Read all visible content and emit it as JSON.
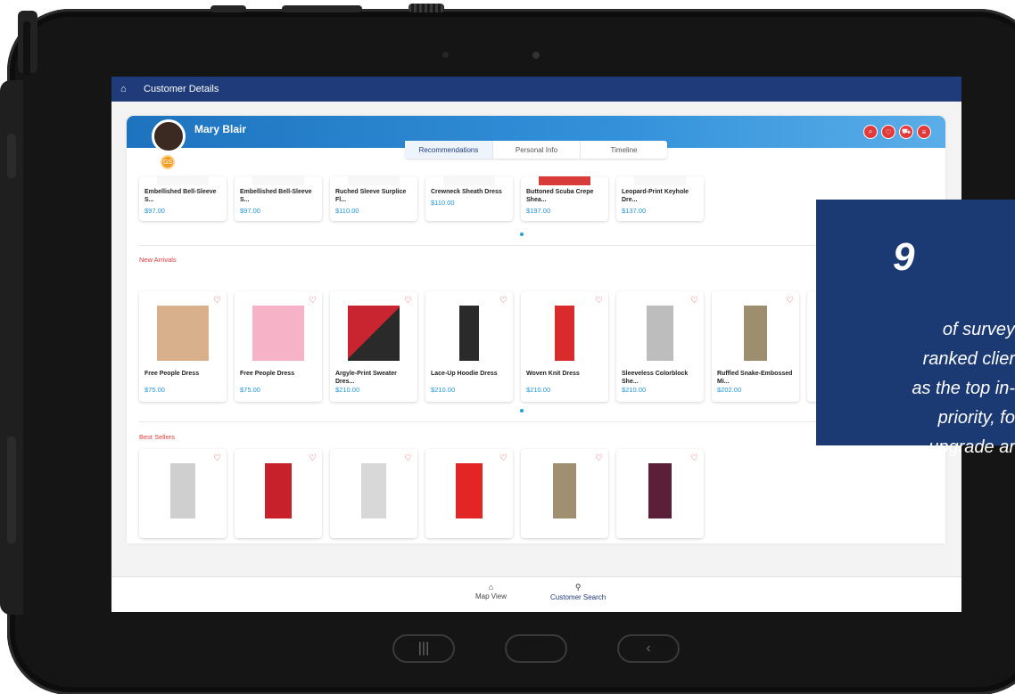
{
  "app": {
    "title": "Customer Details",
    "customer_name": "Mary Blair",
    "badge_text": "GS"
  },
  "tabs": [
    {
      "label": "Recommendations",
      "active": true
    },
    {
      "label": "Personal Info",
      "active": false
    },
    {
      "label": "Timeline",
      "active": false
    }
  ],
  "actions": [
    "search-icon",
    "heart-icon",
    "cart-icon",
    "list-icon"
  ],
  "recommendations": [
    {
      "title": "Embellished Bell-Sleeve S...",
      "price": "$97.00"
    },
    {
      "title": "Embellished Bell-Sleeve S...",
      "price": "$97.00"
    },
    {
      "title": "Ruched Sleeve Surplice Fl...",
      "price": "$110.00"
    },
    {
      "title": "Crewneck Sheath Dress",
      "price": "$110.00"
    },
    {
      "title": "Buttoned Scuba Crepe Shea...",
      "price": "$197.00"
    },
    {
      "title": "Leopard-Print Keyhole Dre...",
      "price": "$137.00"
    }
  ],
  "new_arrivals": {
    "title": "New Arrivals",
    "items": [
      {
        "title": "Free People Dress",
        "price": "$75.00"
      },
      {
        "title": "Free People Dress",
        "price": "$75.00"
      },
      {
        "title": "Argyle-Print Sweater Dres...",
        "price": "$210.00"
      },
      {
        "title": "Lace-Up Hoodie Dress",
        "price": "$210.00"
      },
      {
        "title": "Woven Knit Dress",
        "price": "$210.00"
      },
      {
        "title": "Sleeveless Colorblock She...",
        "price": "$210.00"
      },
      {
        "title": "Ruffled Snake-Embossed Mi...",
        "price": "$202.00"
      }
    ]
  },
  "best_sellers": {
    "title": "Best Sellers",
    "count": 6
  },
  "bottom_nav": [
    {
      "label": "Map View",
      "icon": "home-icon"
    },
    {
      "label": "Customer Search",
      "icon": "person-icon"
    }
  ],
  "stat": {
    "number": "9",
    "lines": [
      "of survey",
      "ranked clier",
      "as the top in-",
      "priority, fo",
      "upgrade ar"
    ]
  },
  "colors": {
    "header": "#1f3b79",
    "accent_red": "#e23a3a",
    "price_blue": "#2196d6",
    "overlay": "#1b3a73"
  }
}
